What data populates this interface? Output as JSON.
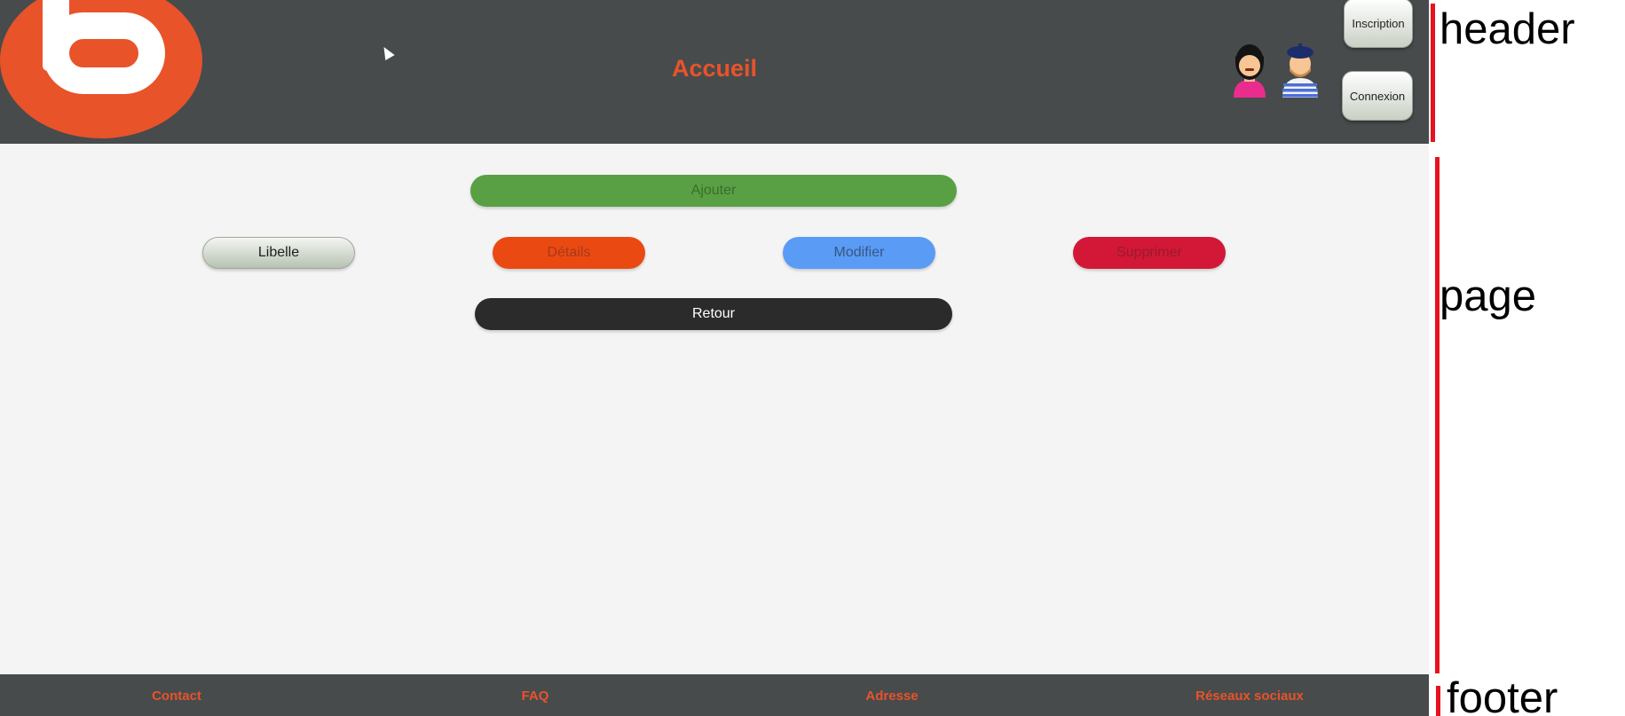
{
  "header": {
    "logo_icon": "boulanger-b-logo",
    "title": "Accueil",
    "avatars": [
      "woman-avatar-icon",
      "man-avatar-icon"
    ],
    "inscription_label": "Inscription",
    "connexion_label": "Connexion"
  },
  "page": {
    "ajouter_label": "Ajouter",
    "libelle_label": "Libelle",
    "details_label": "Détails",
    "modifier_label": "Modifier",
    "supprimer_label": "Supprimer",
    "retour_label": "Retour"
  },
  "footer": {
    "contact_label": "Contact",
    "faq_label": "FAQ",
    "adresse_label": "Adresse",
    "reseaux_label": "Réseaux sociaux"
  },
  "annotations": {
    "header_label": "header",
    "page_label": "page",
    "footer_label": "footer"
  },
  "colors": {
    "brand_orange": "#e8532a",
    "header_bg": "#474b4c",
    "page_bg": "#f4f4f4",
    "add_green": "#58a043",
    "details_orange": "#ea4a12",
    "modify_blue": "#5a9bf6",
    "delete_red": "#d21836",
    "back_black": "#2b2b2b",
    "annotation_red": "#e8121f"
  }
}
